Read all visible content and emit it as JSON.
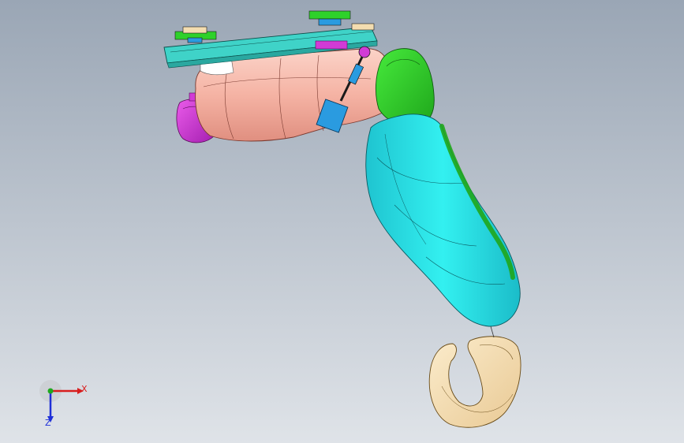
{
  "viewport": {
    "background_top": "#9aa6b5",
    "background_bottom": "#dfe3e8"
  },
  "model": {
    "parts": [
      {
        "name": "mounting-plate",
        "color": "#3fd3c8"
      },
      {
        "name": "upper-arm",
        "color": "#f5b3a4"
      },
      {
        "name": "shoulder-motor",
        "color": "#d13bd6"
      },
      {
        "name": "elbow-cover",
        "color": "#2ed12a"
      },
      {
        "name": "forearm",
        "color": "#2ee6e6"
      },
      {
        "name": "hook-end-effector",
        "color": "#f3ddb0"
      },
      {
        "name": "linkage-rod",
        "color": "#2a9be0"
      }
    ]
  },
  "triad": {
    "x_label": "X",
    "z_label": "Z",
    "x_color": "#d81e1e",
    "y_color": "#1ea81e",
    "z_color": "#1e2fd8"
  }
}
